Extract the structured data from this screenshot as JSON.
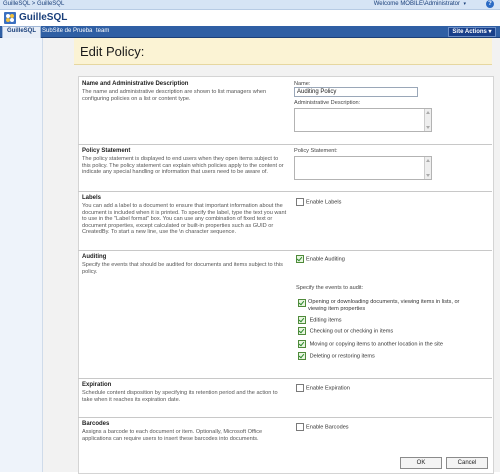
{
  "topbar": {
    "breadcrumb": "GuilleSQL > GuilleSQL",
    "welcome": "Welcome MOBILE\\Administrator",
    "caret": "▾",
    "help": "?"
  },
  "site": {
    "title": "GuilleSQL"
  },
  "tabs": [
    {
      "label": "GuilleSQL"
    },
    {
      "label": "SubSite de Prueba"
    },
    {
      "label": "team"
    }
  ],
  "site_actions": {
    "label": "Site Actions ▾"
  },
  "page": {
    "title": "Edit Policy:"
  },
  "sections": {
    "name": {
      "heading": "Name and Administrative Description",
      "desc": "The name and administrative description are shown to list managers when configuring policies on a list or content type.",
      "name_label": "Name:",
      "name_value": "Auditing Policy",
      "admin_label": "Administrative Description:"
    },
    "statement": {
      "heading": "Policy Statement",
      "desc": "The policy statement is displayed to end users when they open items subject to this policy. The policy statement can explain which policies apply to the content or indicate any special handling or information that users need to be aware of.",
      "label": "Policy Statement:"
    },
    "labels": {
      "heading": "Labels",
      "desc": "You can add a label to a document to ensure that important information about the document is included when it is printed. To specify the label, type the text you want to use in the \"Label format\" box. You can use any combination of fixed text or document properties, except calculated or built-in properties such as GUID or CreatedBy. To start a new line, use the \\n character sequence.",
      "checkbox": "Enable Labels"
    },
    "auditing": {
      "heading": "Auditing",
      "desc": "Specify the events that should be audited for documents and items subject to this policy.",
      "checkbox": "Enable Auditing",
      "events_label": "Specify the events to audit:",
      "events": [
        "Opening or downloading documents, viewing items in lists, or viewing item properties",
        "Editing items",
        "Checking out or checking in items",
        "Moving or copying items to another location in the site",
        "Deleting or restoring items"
      ]
    },
    "expiration": {
      "heading": "Expiration",
      "desc": "Schedule content disposition by specifying its retention period and the action to take when it reaches its expiration date.",
      "checkbox": "Enable Expiration"
    },
    "barcodes": {
      "heading": "Barcodes",
      "desc": "Assigns a barcode to each document or item. Optionally, Microsoft Office applications can require users to insert these barcodes into documents.",
      "checkbox": "Enable Barcodes"
    }
  },
  "buttons": {
    "ok": "OK",
    "cancel": "Cancel"
  },
  "colors": {
    "accent": "#2f5fa4",
    "title_bg": "#fbf3d4",
    "checkbox_green": "#4f8a3a"
  }
}
